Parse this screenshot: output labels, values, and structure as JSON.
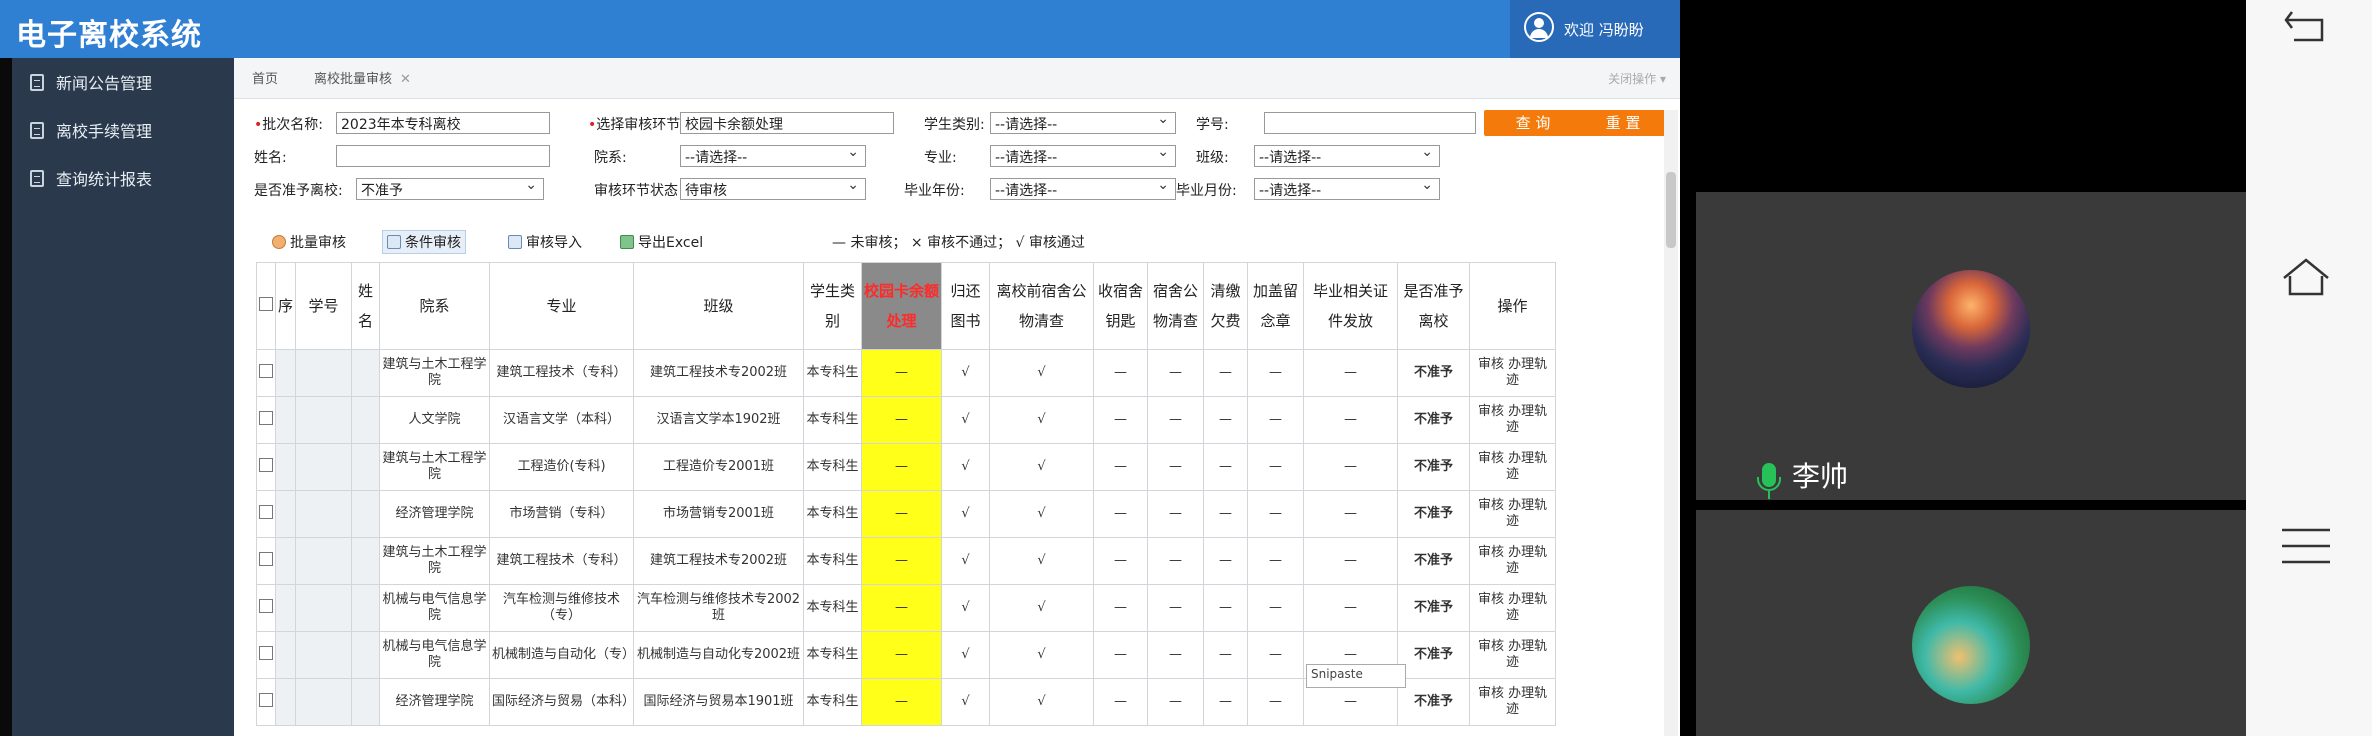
{
  "header": {
    "app_title": "电子离校系统",
    "welcome": "欢迎 冯盼盼"
  },
  "sidebar": {
    "items": [
      {
        "label": "新闻公告管理"
      },
      {
        "label": "离校手续管理"
      },
      {
        "label": "查询统计报表"
      }
    ]
  },
  "tabs": {
    "home": "首页",
    "active": "离校批量审核",
    "close_ops": "关闭操作"
  },
  "filters": {
    "batch_label": "批次名称:",
    "batch_value": "2023年本专科离校",
    "step_label": "选择审核环节:",
    "step_value": "校园卡余额处理",
    "stype_label": "学生类别:",
    "stype_value": "--请选择--",
    "sid_label": "学号:",
    "sid_value": "",
    "name_label": "姓名:",
    "name_value": "",
    "dept_label": "院系:",
    "dept_value": "--请选择--",
    "major_label": "专业:",
    "major_value": "--请选择--",
    "class_label": "班级:",
    "class_value": "--请选择--",
    "allow_label": "是否准予离校:",
    "allow_value": "不准予",
    "status_label": "审核环节状态",
    "status_value": "待审核",
    "gyear_label": "毕业年份:",
    "gyear_value": "--请选择--",
    "gmonth_label": "毕业月份:",
    "gmonth_value": "--请选择--",
    "query_btn": "查 询",
    "reset_btn": "重 置"
  },
  "toolbar": {
    "batch": "批量审核",
    "cond": "条件审核",
    "import": "审核导入",
    "export": "导出Excel",
    "legend": "— 未审核； × 审核不通过； √ 审核通过"
  },
  "table": {
    "headers": [
      "序",
      "学号",
      "姓名",
      "院系",
      "专业",
      "班级",
      "学生类别",
      "校园卡余额处理",
      "归还图书",
      "离校前宿舍公物清查",
      "收宿舍钥匙",
      "宿舍公物清查",
      "清缴欠费",
      "加盖留念章",
      "毕业相关证件发放",
      "是否准予离校",
      "操作"
    ],
    "rows": [
      {
        "dept": "建筑与土木工程学院",
        "major": "建筑工程技术（专科）",
        "cls": "建筑工程技术专2002班",
        "stype": "本专科生",
        "card": "—",
        "book": "√",
        "dorm": "√",
        "key": "—",
        "prop": "—",
        "fee": "—",
        "stamp": "—",
        "cert": "—",
        "allow": "不准予",
        "op": "审核 办理轨迹"
      },
      {
        "dept": "人文学院",
        "major": "汉语言文学（本科）",
        "cls": "汉语言文学本1902班",
        "stype": "本专科生",
        "card": "—",
        "book": "√",
        "dorm": "√",
        "key": "—",
        "prop": "—",
        "fee": "—",
        "stamp": "—",
        "cert": "—",
        "allow": "不准予",
        "op": "审核 办理轨迹"
      },
      {
        "dept": "建筑与土木工程学院",
        "major": "工程造价(专科)",
        "cls": "工程造价专2001班",
        "stype": "本专科生",
        "card": "—",
        "book": "√",
        "dorm": "√",
        "key": "—",
        "prop": "—",
        "fee": "—",
        "stamp": "—",
        "cert": "—",
        "allow": "不准予",
        "op": "审核 办理轨迹"
      },
      {
        "dept": "经济管理学院",
        "major": "市场营销（专科）",
        "cls": "市场营销专2001班",
        "stype": "本专科生",
        "card": "—",
        "book": "√",
        "dorm": "√",
        "key": "—",
        "prop": "—",
        "fee": "—",
        "stamp": "—",
        "cert": "—",
        "allow": "不准予",
        "op": "审核 办理轨迹"
      },
      {
        "dept": "建筑与土木工程学院",
        "major": "建筑工程技术（专科）",
        "cls": "建筑工程技术专2002班",
        "stype": "本专科生",
        "card": "—",
        "book": "√",
        "dorm": "√",
        "key": "—",
        "prop": "—",
        "fee": "—",
        "stamp": "—",
        "cert": "—",
        "allow": "不准予",
        "op": "审核 办理轨迹"
      },
      {
        "dept": "机械与电气信息学院",
        "major": "汽车检测与维修技术（专）",
        "cls": "汽车检测与维修技术专2002班",
        "stype": "本专科生",
        "card": "—",
        "book": "√",
        "dorm": "√",
        "key": "—",
        "prop": "—",
        "fee": "—",
        "stamp": "—",
        "cert": "—",
        "allow": "不准予",
        "op": "审核 办理轨迹"
      },
      {
        "dept": "机械与电气信息学院",
        "major": "机械制造与自动化（专）",
        "cls": "机械制造与自动化专2002班",
        "stype": "本专科生",
        "card": "—",
        "book": "√",
        "dorm": "√",
        "key": "—",
        "prop": "—",
        "fee": "—",
        "stamp": "—",
        "cert": "—",
        "allow": "不准予",
        "op": "审核 办理轨迹"
      },
      {
        "dept": "经济管理学院",
        "major": "国际经济与贸易（本科）",
        "cls": "国际经济与贸易本1901班",
        "stype": "本专科生",
        "card": "—",
        "book": "√",
        "dorm": "√",
        "key": "—",
        "prop": "—",
        "fee": "—",
        "stamp": "—",
        "cert": "—",
        "allow": "不准予",
        "op": "审核 办理轨迹"
      }
    ]
  },
  "tooltip": "Snipaste",
  "meeting": {
    "participant_name": "李帅"
  },
  "colors": {
    "header_blue": "#2f7fd3",
    "sidebar": "#2a3a4c",
    "accent_orange": "#f47a0c",
    "highlight_yellow": "#ffff1a",
    "deny_red": "#e00000"
  },
  "icons": [
    "user-icon",
    "doc-icon",
    "users-icon",
    "grid-icon",
    "import-icon",
    "excel-icon",
    "mic-icon",
    "back-icon",
    "home-icon",
    "menu-icon"
  ]
}
